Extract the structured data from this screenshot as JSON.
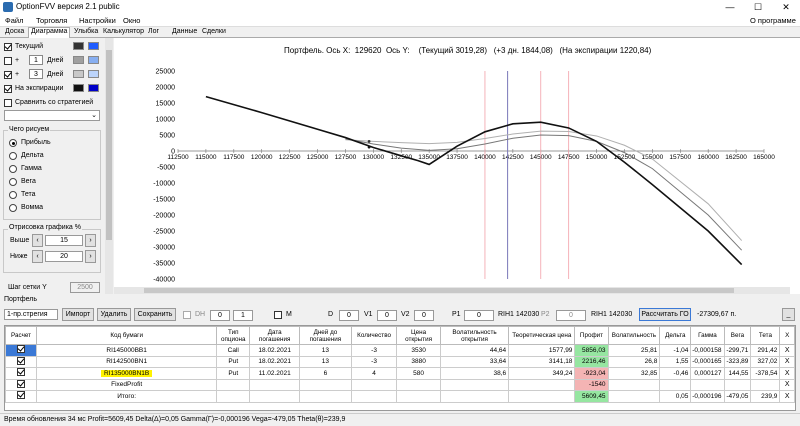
{
  "window": {
    "title": "OptionFVV версия 2.1 public",
    "minimize": "—",
    "maximize": "☐",
    "close": "✕"
  },
  "menu": {
    "items": [
      "Файл",
      "Торговля",
      "Настройки",
      "Окно"
    ],
    "about": "О программе"
  },
  "tabs": [
    "Доска",
    "Диаграмма",
    "Улыбка",
    "Калькулятор",
    "Лог",
    "Данные",
    "Сделки"
  ],
  "active_tab": "Диаграмма",
  "left": {
    "current_label": "Текущий",
    "plus1": "+",
    "days1_value": "1",
    "days_label": "Дней",
    "plus3": "+",
    "days3_value": "3",
    "expiry_label": "На экспирации",
    "compare_label": "Сравнить со стратегией",
    "what_to_draw": "Чего рисуем",
    "options": [
      "Прибыль",
      "Дельта",
      "Гамма",
      "Вега",
      "Тета",
      "Вомма"
    ],
    "render_title": "Отрисовка графика %",
    "above_label": "Выше",
    "above_value": "15",
    "below_label": "Ниже",
    "below_value": "20",
    "grid_step_label": "Шаг сетки Y",
    "grid_step_value": "2500",
    "colors": {
      "current": [
        "#333333",
        "#1f5cff"
      ],
      "plus1": [
        "#a0a0a0",
        "#87aef0"
      ],
      "plus3": [
        "#c8c8c8",
        "#bcd4fa"
      ],
      "expiry": [
        "#111111",
        "#0000c8"
      ]
    }
  },
  "chart_title": "Портфель. Ось X:  129620  Ось Y:    (Текущий 3019,28)   (+3 дн. 1844,08)   (На экспирации 1220,84)",
  "chart_data": {
    "type": "line",
    "x_ticks": [
      "112500",
      "115000",
      "117500",
      "120000",
      "122500",
      "125000",
      "127500",
      "130000",
      "132500",
      "135000",
      "137500",
      "140000",
      "142500",
      "145000",
      "147500",
      "150000",
      "152500",
      "155000",
      "157500",
      "160000",
      "162500",
      "165000"
    ],
    "y_ticks": [
      "25000",
      "20000",
      "15000",
      "10000",
      "5000",
      "0",
      "-5000",
      "-10000",
      "-15000",
      "-20000",
      "-25000",
      "-30000",
      "-35000",
      "-40000"
    ],
    "xlim": [
      112500,
      165000
    ],
    "ylim": [
      -40000,
      25000
    ],
    "series": [
      {
        "color": "#111111",
        "x": [
          115000,
          120000,
          125000,
          127500,
          130000,
          132500,
          134000,
          135000,
          137500,
          140000,
          142500,
          145000,
          147500,
          150000,
          152500,
          155000,
          160000,
          163000
        ],
        "y": [
          17000,
          12000,
          6800,
          4200,
          1100,
          -1500,
          -3000,
          -4200,
          1500,
          6000,
          8500,
          9000,
          7200,
          3000,
          -3500,
          -10500,
          -25000,
          -35500
        ]
      },
      {
        "color": "#777777",
        "x": [
          127500,
          130000,
          132500,
          135000,
          137500,
          140000,
          142500,
          145000,
          147500,
          150000,
          152500,
          155000,
          160000,
          163000
        ],
        "y": [
          3800,
          2200,
          900,
          200,
          700,
          2200,
          4000,
          5000,
          4800,
          3000,
          -500,
          -5500,
          -20000,
          -31000
        ]
      },
      {
        "color": "#b0b0b0",
        "x": [
          127500,
          130000,
          132500,
          135000,
          137500,
          140000,
          142500,
          145000,
          147500,
          150000,
          152500,
          155000,
          160000,
          163000
        ],
        "y": [
          3500,
          3000,
          2600,
          2300,
          2700,
          3900,
          5300,
          6200,
          6100,
          4700,
          1800,
          -2500,
          -16500,
          -28000
        ]
      }
    ],
    "current_price_line": 142030,
    "strike_lines": [
      140000,
      145000,
      147500
    ]
  },
  "toolbar": {
    "strategy_select": "1-пр.стрегия",
    "import": "Импорт",
    "delete": "Удалить",
    "save": "Сохранить",
    "dh_label": "DH",
    "dh_value": "0",
    "step_value": "1",
    "m_label": "M",
    "d_label": "D",
    "d_value": "0",
    "v1_label": "V1",
    "v1_value": "0",
    "v2_label": "V2",
    "v2_value": "0",
    "p1_label": "P1",
    "p1_value": "0",
    "p1_ticker": "RIH1 142030",
    "p2_label": "P2",
    "p2_value": "0",
    "p2_ticker": "RIH1 142030",
    "calc_go": "Рассчитать ГО",
    "go_value": "-27309,67 п.",
    "min_btn": "_"
  },
  "portfolio_label": "Портфель",
  "grid": {
    "headers": [
      "Расчет",
      "Код бумаги",
      "Тип опциона",
      "Дата погашения",
      "Дней до погашения",
      "Количество",
      "Цена открытия",
      "Волатильность открытия",
      "Теоретическая цена",
      "Профит",
      "Волатильность",
      "Дельта",
      "Гамма",
      "Вега",
      "Тета",
      "X"
    ],
    "rows": [
      {
        "code": "RI145000BB1",
        "type": "Call",
        "date": "18.02.2021",
        "days": "13",
        "qty": "-3",
        "price": "3530",
        "vol_open": "44,64",
        "theo": "1577,99",
        "profit": "5856,03",
        "vol": "25,81",
        "delta": "-1,04",
        "gamma": "-0,000158",
        "vega": "-299,71",
        "theta": "291,42",
        "x": "X"
      },
      {
        "code": "RI142500BN1",
        "type": "Put",
        "date": "18.02.2021",
        "days": "13",
        "qty": "-3",
        "price": "3880",
        "vol_open": "33,64",
        "theo": "3141,18",
        "profit": "2216,46",
        "vol": "26,8",
        "delta": "1,55",
        "gamma": "-0,000165",
        "vega": "-323,89",
        "theta": "327,02",
        "x": "X"
      },
      {
        "code": "RI135000BN1B",
        "type": "Put",
        "date": "11.02.2021",
        "days": "6",
        "qty": "4",
        "price": "580",
        "vol_open": "38,6",
        "theo": "349,24",
        "profit": "-923,04",
        "vol": "32,85",
        "delta": "-0,46",
        "gamma": "0,000127",
        "vega": "144,55",
        "theta": "-378,54",
        "x": "X"
      },
      {
        "code": "FixedProfit",
        "type": "",
        "date": "",
        "days": "",
        "qty": "",
        "price": "",
        "vol_open": "",
        "theo": "",
        "profit": "-1540",
        "vol": "",
        "delta": "",
        "gamma": "",
        "vega": "",
        "theta": "",
        "x": "X"
      },
      {
        "code": "Итого:",
        "type": "",
        "date": "",
        "days": "",
        "qty": "",
        "price": "",
        "vol_open": "",
        "theo": "",
        "profit": "5609,45",
        "vol": "",
        "delta": "0,05",
        "gamma": "-0,000196",
        "vega": "-479,05",
        "theta": "239,9",
        "x": "X"
      }
    ]
  },
  "status": "Время обновления 34 мс   Profit=5609,45 Delta(Δ)=0,05 Gamma(Γ)=-0,000196 Vega=-479,05 Theta(θ)=239,9"
}
